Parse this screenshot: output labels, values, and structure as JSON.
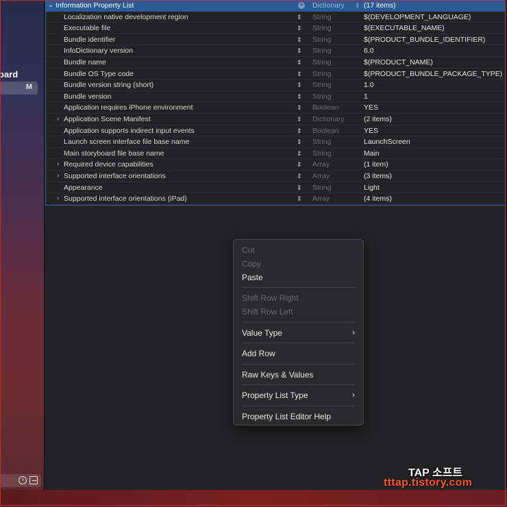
{
  "sidebar": {
    "partial_label": "oard",
    "row_badge": "M"
  },
  "plist": {
    "header": {
      "key": "Information Property List",
      "type": "Dictionary",
      "value": "(17 items)"
    },
    "rows": [
      {
        "key": "Localization native development region",
        "type": "String",
        "value": "$(DEVELOPMENT_LANGUAGE)",
        "expandable": false
      },
      {
        "key": "Executable file",
        "type": "String",
        "value": "$(EXECUTABLE_NAME)",
        "expandable": false
      },
      {
        "key": "Bundle identifier",
        "type": "String",
        "value": "$(PRODUCT_BUNDLE_IDENTIFIER)",
        "expandable": false
      },
      {
        "key": "InfoDictionary version",
        "type": "String",
        "value": "6.0",
        "expandable": false
      },
      {
        "key": "Bundle name",
        "type": "String",
        "value": "$(PRODUCT_NAME)",
        "expandable": false
      },
      {
        "key": "Bundle OS Type code",
        "type": "String",
        "value": "$(PRODUCT_BUNDLE_PACKAGE_TYPE)",
        "expandable": false
      },
      {
        "key": "Bundle version string (short)",
        "type": "String",
        "value": "1.0",
        "expandable": false
      },
      {
        "key": "Bundle version",
        "type": "String",
        "value": "1",
        "expandable": false
      },
      {
        "key": "Application requires iPhone environment",
        "type": "Boolean",
        "value": "YES",
        "expandable": false
      },
      {
        "key": "Application Scene Manifest",
        "type": "Dictionary",
        "value": "(2 items)",
        "expandable": true
      },
      {
        "key": "Application supports indirect input events",
        "type": "Boolean",
        "value": "YES",
        "expandable": false
      },
      {
        "key": "Launch screen interface file base name",
        "type": "String",
        "value": "LaunchScreen",
        "expandable": false
      },
      {
        "key": "Main storyboard file base name",
        "type": "String",
        "value": "Main",
        "expandable": false
      },
      {
        "key": "Required device capabilities",
        "type": "Array",
        "value": "(1 item)",
        "expandable": true
      },
      {
        "key": "Supported interface orientations",
        "type": "Array",
        "value": "(3 items)",
        "expandable": true
      },
      {
        "key": "Appearance",
        "type": "String",
        "value": "Light",
        "expandable": false
      },
      {
        "key": "Supported interface orientations (iPad)",
        "type": "Array",
        "value": "(4 items)",
        "expandable": true
      }
    ]
  },
  "menu": {
    "cut": "Cut",
    "copy": "Copy",
    "paste": "Paste",
    "shift_right": "Shift Row Right",
    "shift_left": "Shift Row Left",
    "value_type": "Value Type",
    "add_row": "Add Row",
    "raw_keys": "Raw Keys & Values",
    "plist_type": "Property List Type",
    "editor_help": "Property List Editor Help"
  },
  "watermark": {
    "line1": "TAP 소프트",
    "line2": "tttap.tistory.com"
  },
  "icons": {
    "disclosure_collapsed": "›",
    "disclosure_expanded": "⌄",
    "stepper": "⇕",
    "submenu": "›"
  }
}
